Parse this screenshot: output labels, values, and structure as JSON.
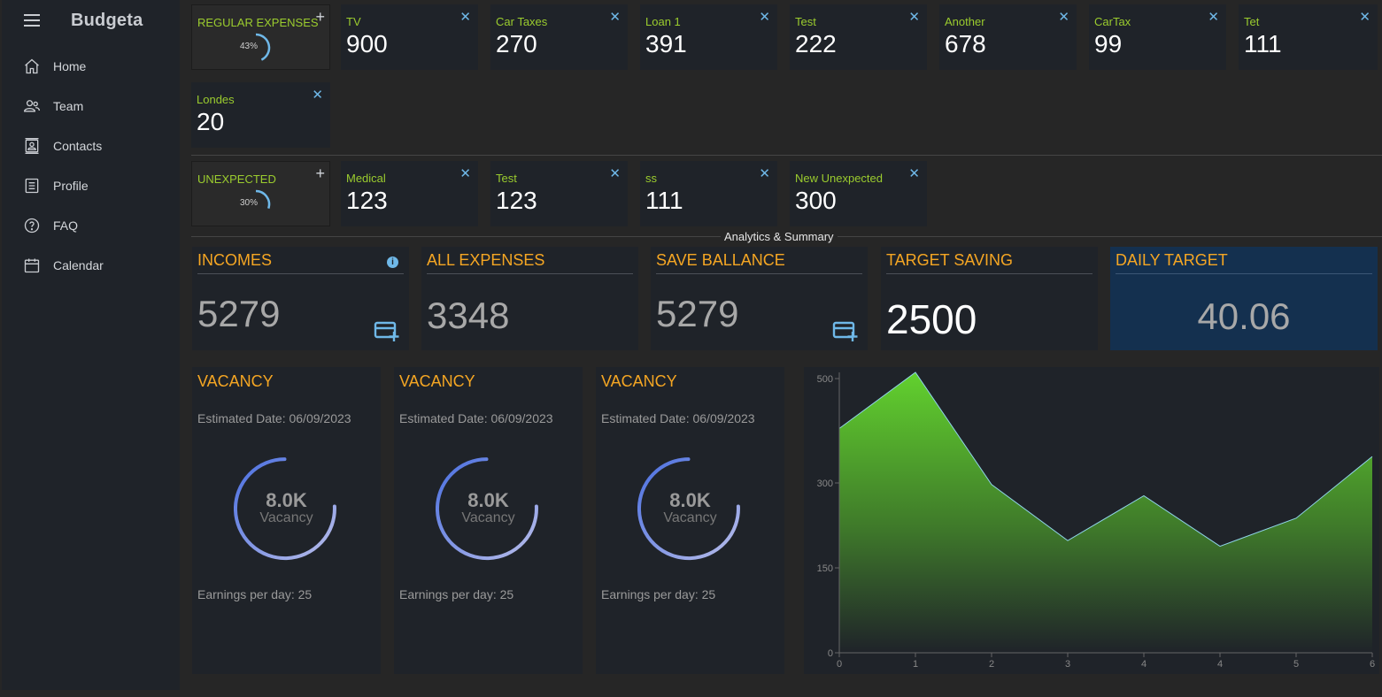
{
  "app": {
    "brand": "Budgeta"
  },
  "sidebar": {
    "items": [
      {
        "label": "Home",
        "icon": "home-icon"
      },
      {
        "label": "Team",
        "icon": "team-icon"
      },
      {
        "label": "Contacts",
        "icon": "contacts-icon"
      },
      {
        "label": "Profile",
        "icon": "profile-icon"
      },
      {
        "label": "FAQ",
        "icon": "help-circle-icon"
      },
      {
        "label": "Calendar",
        "icon": "calendar-icon"
      }
    ]
  },
  "regular": {
    "title": "REGULAR EXPENSES",
    "percent_label": "43%",
    "percent": 0.43,
    "items": [
      {
        "name": "TV",
        "value": "900"
      },
      {
        "name": "Car Taxes",
        "value": "270"
      },
      {
        "name": "Loan 1",
        "value": "391"
      },
      {
        "name": "Test",
        "value": "222"
      },
      {
        "name": "Another",
        "value": "678"
      },
      {
        "name": "CarTax",
        "value": "99"
      },
      {
        "name": "Tet",
        "value": "111"
      },
      {
        "name": "Londes",
        "value": "20"
      }
    ]
  },
  "unexpected": {
    "title": "UNEXPECTED",
    "percent_label": "30%",
    "percent": 0.3,
    "items": [
      {
        "name": "Medical",
        "value": "123"
      },
      {
        "name": "Test",
        "value": "123"
      },
      {
        "name": "ss",
        "value": "111"
      },
      {
        "name": "New Unexpected",
        "value": "300"
      }
    ]
  },
  "section": {
    "label": "Analytics & Summary"
  },
  "summary": {
    "incomes": {
      "title": "INCOMES",
      "value": "5279"
    },
    "all_expenses": {
      "title": "ALL EXPENSES",
      "value": "3348"
    },
    "save_balance": {
      "title": "SAVE BALLANCE",
      "value": "5279"
    },
    "target_saving": {
      "title": "TARGET SAVING",
      "value": "2500"
    },
    "daily_target": {
      "title": "DAILY TARGET",
      "value": "40.06"
    }
  },
  "vacancies": [
    {
      "title": "VACANCY",
      "date": "Estimated Date: 06/09/2023",
      "amount": "8.0K",
      "sub": "Vacancy",
      "earnings": "Earnings per day: 25"
    },
    {
      "title": "VACANCY",
      "date": "Estimated Date: 06/09/2023",
      "amount": "8.0K",
      "sub": "Vacancy",
      "earnings": "Earnings per day: 25"
    },
    {
      "title": "VACANCY",
      "date": "Estimated Date: 06/09/2023",
      "amount": "8.0K",
      "sub": "Vacancy",
      "earnings": "Earnings per day: 25"
    }
  ],
  "colors": {
    "accent_orange": "#f5a623",
    "accent_green": "#9bcc2e",
    "accent_blue": "#6fb8e8",
    "daily_target_bg": "#14304f"
  },
  "chart_data": {
    "type": "area",
    "x": [
      "0",
      "1",
      "2",
      "3",
      "4",
      "4",
      "5",
      "6"
    ],
    "values": [
      400,
      500,
      300,
      200,
      280,
      190,
      240,
      350
    ],
    "yticks": [
      "0",
      "150",
      "300",
      "500"
    ],
    "ylim": [
      0,
      500
    ],
    "grid": false,
    "title": "",
    "xlabel": "",
    "ylabel": ""
  }
}
